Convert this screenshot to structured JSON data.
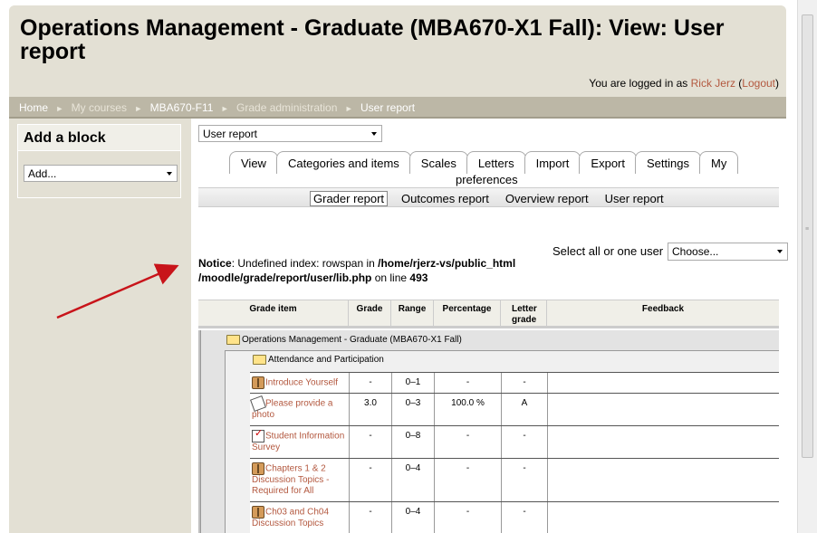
{
  "header": {
    "title": "Operations Management - Graduate (MBA670-X1 Fall): View: User report",
    "login_prefix": "You are logged in as ",
    "user_name": "Rick Jerz",
    "logout_open": " (",
    "logout_label": "Logout",
    "logout_close": ")"
  },
  "breadcrumb": {
    "items": [
      "Home",
      "My courses",
      "MBA670-F11",
      "Grade administration",
      "User report"
    ],
    "separator": "►"
  },
  "add_block": {
    "title": "Add a block",
    "select_value": "Add..."
  },
  "report_select": {
    "value": "User report"
  },
  "tabs": {
    "items": [
      "View",
      "Categories and items",
      "Scales",
      "Letters",
      "Import",
      "Export",
      "Settings",
      "My"
    ],
    "overflow_label": "preferences"
  },
  "subtabs": [
    "Grader report",
    "Outcomes report",
    "Overview report",
    "User report"
  ],
  "user_select": {
    "label": "Select all or one user",
    "value": "Choose..."
  },
  "notice": {
    "label": "Notice",
    "text_1": ": Undefined index: rowspan in ",
    "path": "/home/rjerz-vs/public_html /moodle/grade/report/user/lib.php",
    "text_2": " on line ",
    "line": "493"
  },
  "grade_table": {
    "headers": [
      "Grade item",
      "Grade",
      "Range",
      "Percentage",
      "Letter grade",
      "Feedback"
    ],
    "course": "Operations Management - Graduate (MBA670-X1 Fall)",
    "category": "Attendance and Participation",
    "rows": [
      {
        "icon": "forum-icon",
        "name": "Introduce Yourself",
        "grade": "-",
        "range": "0–1",
        "percentage": "-",
        "letter": "-",
        "feedback": ""
      },
      {
        "icon": "assignment-icon",
        "name": "Please provide a photo",
        "grade": "3.0",
        "range": "0–3",
        "percentage": "100.0 %",
        "letter": "A",
        "feedback": ""
      },
      {
        "icon": "quiz-icon",
        "name": "Student Information Survey",
        "grade": "-",
        "range": "0–8",
        "percentage": "-",
        "letter": "-",
        "feedback": ""
      },
      {
        "icon": "forum-icon",
        "name": "Chapters 1 & 2 Discussion Topics - Required for All",
        "grade": "-",
        "range": "0–4",
        "percentage": "-",
        "letter": "-",
        "feedback": ""
      },
      {
        "icon": "forum-icon",
        "name": "Ch03 and Ch04 Discussion Topics",
        "grade": "-",
        "range": "0–4",
        "percentage": "-",
        "letter": "-",
        "feedback": ""
      }
    ]
  },
  "colors": {
    "page_background": "#e3e0d4",
    "navbar": "#bcb7a6",
    "link": "#b3583f",
    "annotation_arrow": "#c8141a"
  }
}
